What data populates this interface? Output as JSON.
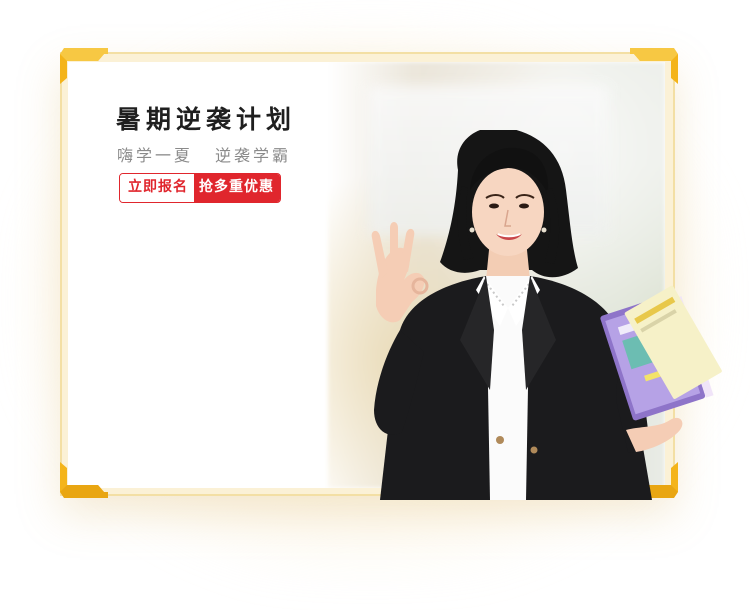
{
  "banner": {
    "headline": "暑期逆袭计划",
    "subline_left": "嗨学一夏",
    "subline_right": "逆袭学霸",
    "cta_left_label": "立即报名",
    "cta_right_label": "抢多重优惠"
  },
  "colors": {
    "accent_red": "#e0262d",
    "gold": "#f4b41a",
    "frame": "#fbf1d6"
  },
  "icons": {
    "corners": "gold-corner-bracket-icon",
    "person": "teacher-with-books-photo"
  }
}
